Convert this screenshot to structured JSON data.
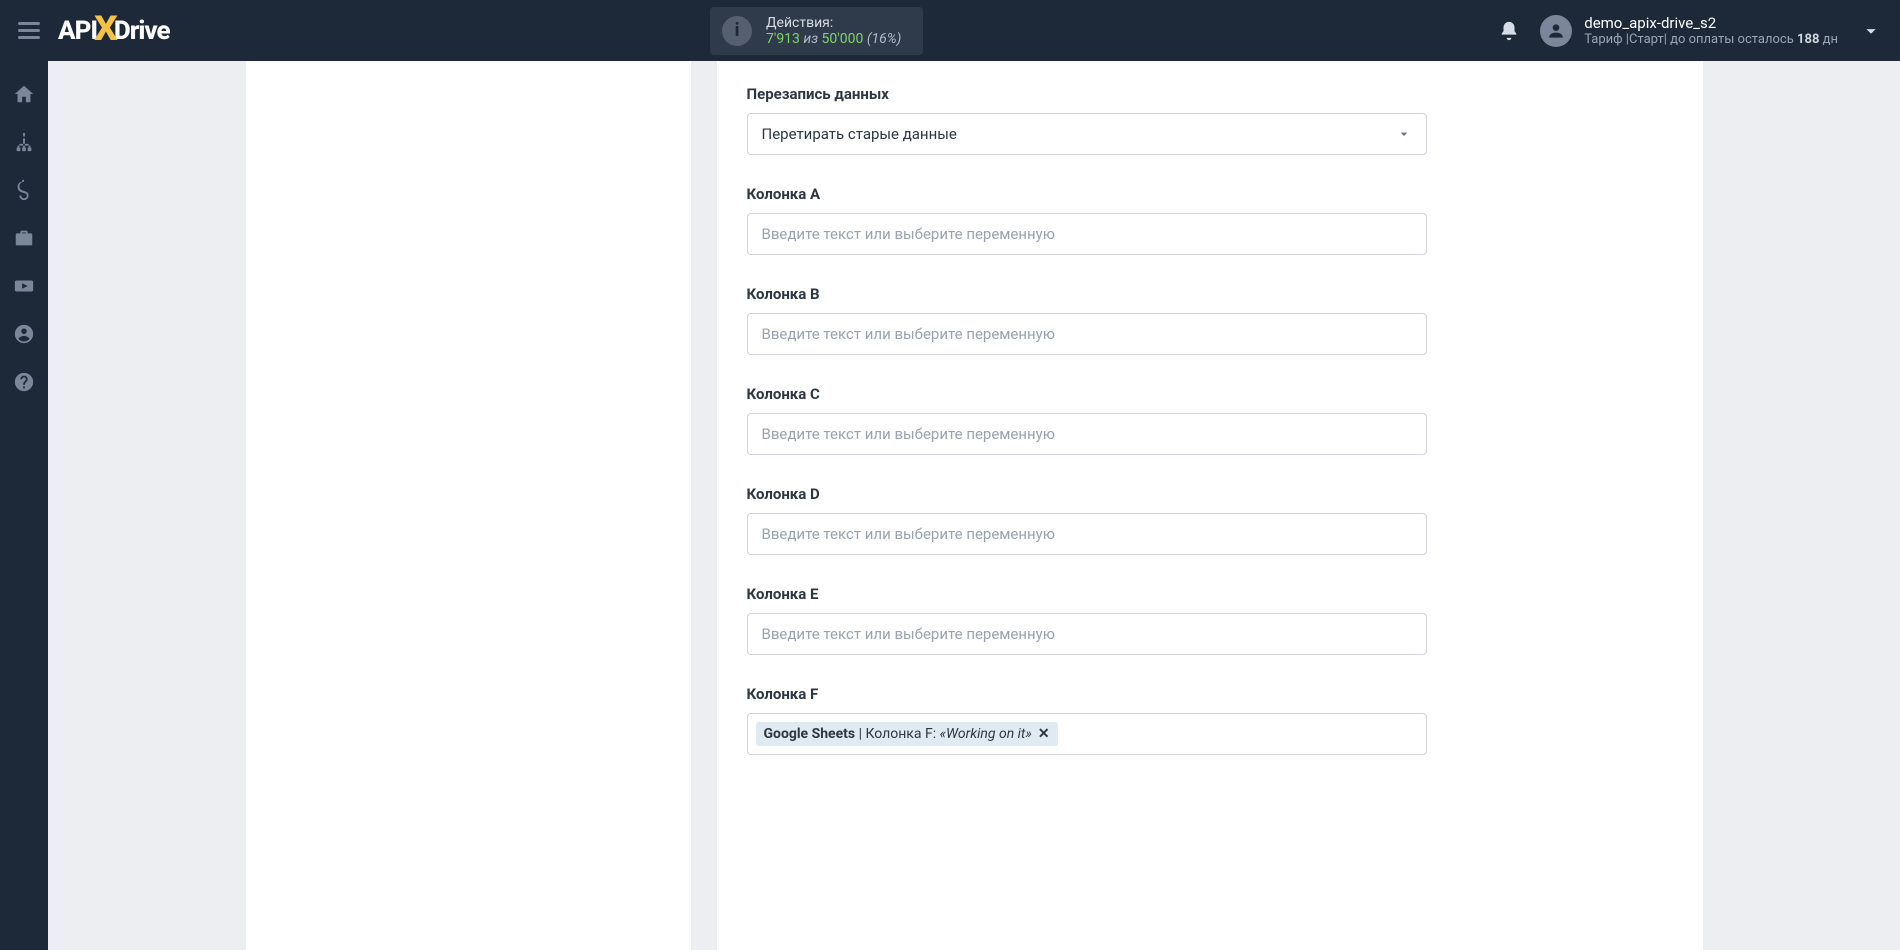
{
  "brand": {
    "pre": "API",
    "post": "Drive"
  },
  "header": {
    "actions_label": "Действия:",
    "actions_used": "7'913",
    "actions_sep": " из ",
    "actions_total": "50'000",
    "actions_pct": "(16%)"
  },
  "user": {
    "name": "demo_apix-drive_s2",
    "tariff_pre": "Тариф |Старт| до оплаты осталось ",
    "tariff_days": "188",
    "tariff_suf": " дн"
  },
  "form": {
    "overwrite_label": "Перезапись данных",
    "overwrite_value": "Перетирать старые данные",
    "placeholder": "Введите текст или выберите переменную",
    "cols": {
      "a": "Колонка A",
      "b": "Колонка B",
      "c": "Колонка C",
      "d": "Колонка D",
      "e": "Колонка E",
      "f": "Колонка F"
    },
    "tag": {
      "src": "Google Sheets",
      "mid": " | Колонка F: ",
      "val": "«Working on it»"
    }
  }
}
